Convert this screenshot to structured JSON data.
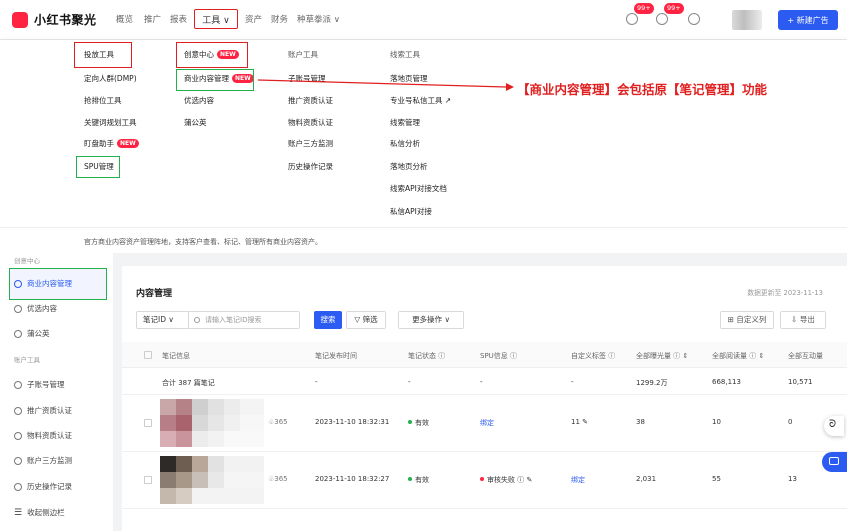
{
  "brand": {
    "name": "小红书聚光",
    "logo_color": "#ff2442"
  },
  "topnav": {
    "items": [
      "概览",
      "推广",
      "报表",
      "资产",
      "财务",
      "种草拳派 ∨"
    ],
    "tools_label": "工具 ∨",
    "badges": [
      "99+",
      "99+"
    ],
    "new_ad_label": "+ 新建广告"
  },
  "dropdown": {
    "col1": [
      "投放工具",
      "定向人群(DMP)",
      "抢排位工具",
      "关键词规划工具",
      "盯盘助手",
      "SPU管理"
    ],
    "col2": [
      "创意中心",
      "商业内容管理",
      "优选内容",
      "蒲公英"
    ],
    "col3": [
      "账户工具",
      "子账号管理",
      "推广资质认证",
      "物料资质认证",
      "账户三方监测",
      "历史操作记录"
    ],
    "col4": [
      "线索工具",
      "落地页管理",
      "专业号私信工具 ↗",
      "线索管理",
      "私信分析",
      "落地页分析",
      "线索API对接文档",
      "私信API对接"
    ],
    "new_tag": "NEW",
    "footer_text": "官方商业内容资产管理阵地，支持客户查看、标记、管理所有商业内容资产。"
  },
  "annotation": "【商业内容管理】会包括原【笔记管理】功能",
  "sidebar": {
    "section1": "创意中心",
    "active_item": "商业内容管理",
    "items1": [
      "优选内容",
      "蒲公英"
    ],
    "section2": "账户工具",
    "items2": [
      "子账号管理",
      "推广资质认证",
      "物料资质认证",
      "账户三方监测",
      "历史操作记录"
    ],
    "collapse": "收起侧边栏"
  },
  "main": {
    "title": "内容管理",
    "update_time": "数据更新至 2023-11-13",
    "select_value": "笔记ID   ∨",
    "search_placeholder": "请输入笔记ID搜索",
    "search_btn": "搜索",
    "filter_btn": "▽ 筛选",
    "more_btn": "更多操作 ∨",
    "custom_col": "⊞ 自定义列",
    "export_btn": "⇩ 导出",
    "columns": [
      "笔记信息",
      "笔记发布时间",
      "笔记状态 ⓘ",
      "SPU信息 ⓘ",
      "自定义标签 ⓘ",
      "全部曝光量 ⓘ ⇕",
      "全部阅读量 ⓘ ⇕",
      "全部互动量"
    ],
    "total_row": {
      "label": "合计 387 篇笔记",
      "c2": "-",
      "c3": "-",
      "c4": "-",
      "c5": "-",
      "impressions": "1299.2万",
      "reads": "668,113",
      "interactions": "10,571"
    },
    "rows": [
      {
        "likes": "♧365",
        "time": "2023-11-10 18:32:31",
        "status": "有效",
        "spu": "绑定",
        "tag": "11 ✎",
        "impressions": "38",
        "reads": "10",
        "interactions": "0"
      },
      {
        "likes": "♧365",
        "time": "2023-11-10 18:32:27",
        "status": "有效",
        "spu": "审核失败 ⓘ ✎",
        "tag": "绑定",
        "impressions": "2,031",
        "reads": "55",
        "interactions": "13"
      }
    ]
  },
  "colors": {
    "accent": "#2b5bf0",
    "highlight_red": "#e02020",
    "highlight_green": "#22b14c",
    "status_green": "#22b14c",
    "status_red": "#ff2442"
  }
}
